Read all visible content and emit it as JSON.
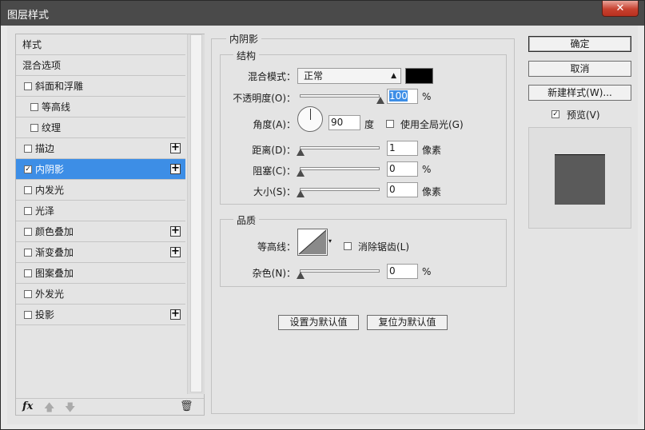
{
  "window": {
    "title": "图层样式",
    "close_glyph": "✕"
  },
  "list": {
    "items": [
      {
        "label": "样式",
        "checkbox": false,
        "checked": false,
        "plus": false,
        "indent": 0,
        "selected": false
      },
      {
        "label": "混合选项",
        "checkbox": false,
        "checked": false,
        "plus": false,
        "indent": 0,
        "selected": false
      },
      {
        "label": "斜面和浮雕",
        "checkbox": true,
        "checked": false,
        "plus": false,
        "indent": 0,
        "selected": false
      },
      {
        "label": "等高线",
        "checkbox": true,
        "checked": false,
        "plus": false,
        "indent": 1,
        "selected": false
      },
      {
        "label": "纹理",
        "checkbox": true,
        "checked": false,
        "plus": false,
        "indent": 1,
        "selected": false
      },
      {
        "label": "描边",
        "checkbox": true,
        "checked": false,
        "plus": true,
        "indent": 0,
        "selected": false
      },
      {
        "label": "内阴影",
        "checkbox": true,
        "checked": true,
        "plus": true,
        "indent": 0,
        "selected": true
      },
      {
        "label": "内发光",
        "checkbox": true,
        "checked": false,
        "plus": false,
        "indent": 0,
        "selected": false
      },
      {
        "label": "光泽",
        "checkbox": true,
        "checked": false,
        "plus": false,
        "indent": 0,
        "selected": false
      },
      {
        "label": "颜色叠加",
        "checkbox": true,
        "checked": false,
        "plus": true,
        "indent": 0,
        "selected": false
      },
      {
        "label": "渐变叠加",
        "checkbox": true,
        "checked": false,
        "plus": true,
        "indent": 0,
        "selected": false
      },
      {
        "label": "图案叠加",
        "checkbox": true,
        "checked": false,
        "plus": false,
        "indent": 0,
        "selected": false
      },
      {
        "label": "外发光",
        "checkbox": true,
        "checked": false,
        "plus": false,
        "indent": 0,
        "selected": false
      },
      {
        "label": "投影",
        "checkbox": true,
        "checked": false,
        "plus": true,
        "indent": 0,
        "selected": false
      }
    ],
    "footer": {
      "fx": "fx",
      "up": "🡅",
      "down": "🡇",
      "trash": "🗑"
    }
  },
  "panel": {
    "title": "内阴影",
    "structure": {
      "title": "结构",
      "blend_mode_label": "混合模式：",
      "blend_mode_value": "正常",
      "blend_color": "#000000",
      "opacity_label": "不透明度(O)：",
      "opacity_value": "100",
      "opacity_level": 1.0,
      "percent": "%",
      "angle_label": "角度(A)：",
      "angle_value": "90",
      "angle_unit": "度",
      "global_light_label": "使用全局光(G)",
      "global_light_checked": false,
      "distance_label": "距离(D)：",
      "distance_value": "1",
      "distance_unit": "像素",
      "choke_label": "阻塞(C)：",
      "choke_value": "0",
      "size_label": "大小(S)：",
      "size_value": "0",
      "size_unit": "像素"
    },
    "quality": {
      "title": "品质",
      "contour_label": "等高线：",
      "antialias_label": "消除锯齿(L)",
      "antialias_checked": false,
      "noise_label": "杂色(N)：",
      "noise_value": "0",
      "percent": "%"
    },
    "set_default": "设置为默认值",
    "reset_default": "复位为默认值"
  },
  "right": {
    "ok": "确定",
    "cancel": "取消",
    "new_style": "新建样式(W)...",
    "preview_label": "预览(V)",
    "preview_checked": true,
    "preview_swatch_color": "#5a5a5a"
  }
}
